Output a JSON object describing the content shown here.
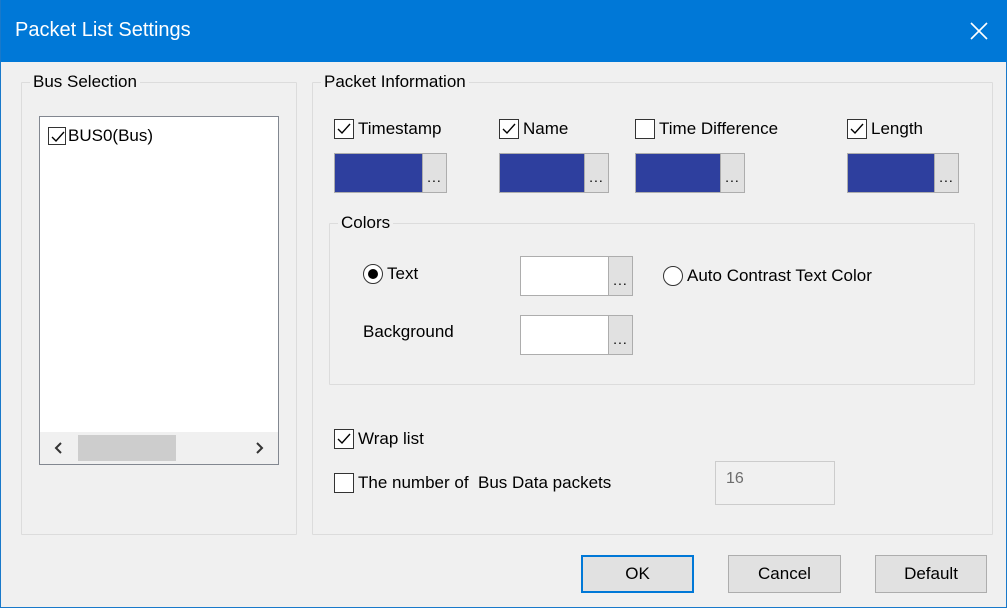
{
  "window": {
    "title": "Packet List Settings",
    "close_icon": "close-icon"
  },
  "bus_selection": {
    "legend": "Bus Selection",
    "items": [
      {
        "label": "BUS0(Bus)",
        "checked": true
      }
    ],
    "scroll_left_icon": "chevron-left-icon",
    "scroll_right_icon": "chevron-right-icon"
  },
  "packet_information": {
    "legend": "Packet Information",
    "fields": [
      {
        "label": "Timestamp",
        "checked": true,
        "color": "#2e3f9e"
      },
      {
        "label": "Name",
        "checked": true,
        "color": "#2e3f9e"
      },
      {
        "label": "Time Difference",
        "checked": false,
        "color": "#2e3f9e"
      },
      {
        "label": "Length",
        "checked": true,
        "color": "#2e3f9e"
      }
    ],
    "ellipsis": "..."
  },
  "colors": {
    "legend": "Colors",
    "text_label": "Text",
    "text_selected": true,
    "text_color": "#ffffff",
    "auto_contrast_label": "Auto Contrast Text Color",
    "auto_contrast_selected": false,
    "background_label": "Background",
    "background_color": "#ffffff"
  },
  "options": {
    "wrap_list_label": "Wrap list",
    "wrap_list_checked": true,
    "bus_packets_label": "The number of  Bus Data packets",
    "bus_packets_checked": false,
    "bus_packets_value": "16"
  },
  "buttons": {
    "ok": "OK",
    "cancel": "Cancel",
    "default": "Default"
  },
  "theme": {
    "titlebar": "#0078d7",
    "swatch_blue": "#2e3f9e",
    "focus_border": "#0078d7"
  }
}
